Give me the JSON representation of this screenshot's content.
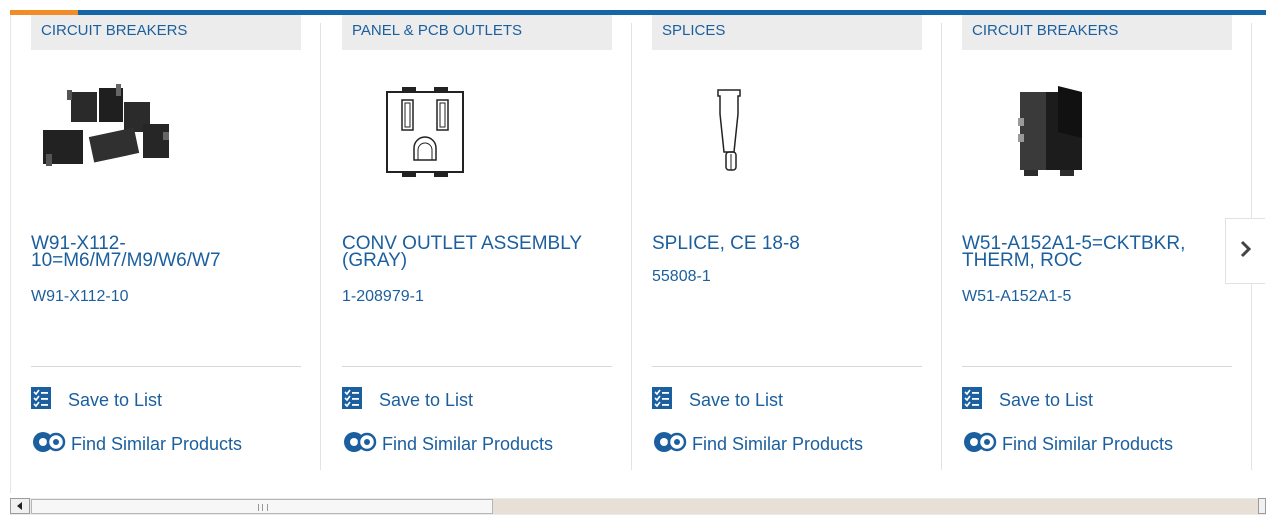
{
  "colors": {
    "brand_blue": "#1565a7",
    "link_blue": "#1b5f9e",
    "accent_orange": "#f28c28",
    "category_bg": "#ececec"
  },
  "products": [
    {
      "category": "CIRCUIT BREAKERS",
      "title": "W91-X112-10=M6/M7/M9/W6/W7",
      "part_number": "W91-X112-10",
      "image_icon": "circuit-breakers-group-photo",
      "save_label": "Save to List",
      "similar_label": "Find Similar Products"
    },
    {
      "category": "PANEL & PCB OUTLETS",
      "title": "CONV OUTLET ASSEMBLY (GRAY)",
      "part_number": "1-208979-1",
      "image_icon": "outlet-drawing",
      "save_label": "Save to List",
      "similar_label": "Find Similar Products"
    },
    {
      "category": "SPLICES",
      "title": "SPLICE, CE 18-8",
      "part_number": "55808-1",
      "image_icon": "splice-drawing",
      "save_label": "Save to List",
      "similar_label": "Find Similar Products"
    },
    {
      "category": "CIRCUIT BREAKERS",
      "title": "W51-A152A1-5=CKTBKR, THERM, ROC",
      "part_number": "W51-A152A1-5",
      "image_icon": "rocker-breaker-photo",
      "save_label": "Save to List",
      "similar_label": "Find Similar Products"
    }
  ],
  "controls": {
    "next_icon": "chevron-right-icon",
    "save_icon": "checklist-icon",
    "similar_icon": "gears-icon"
  }
}
